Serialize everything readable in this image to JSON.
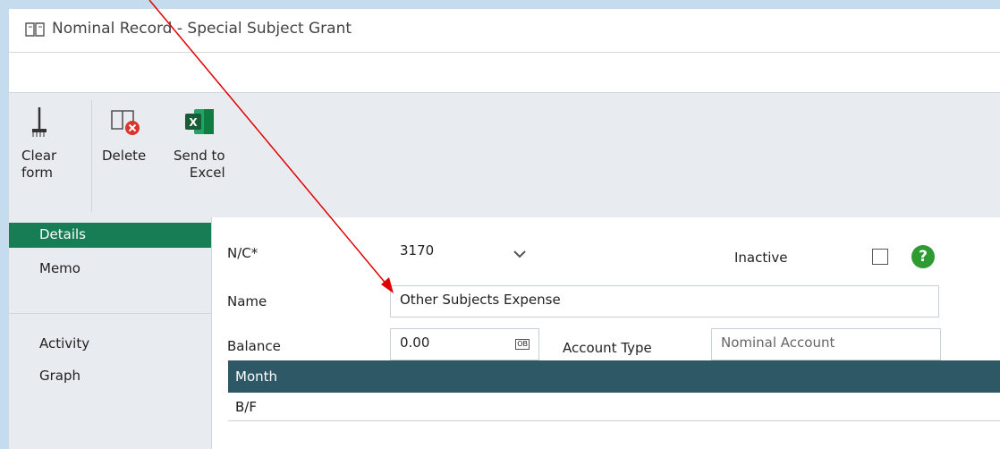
{
  "window": {
    "title": "Nominal Record - Special Subject Grant"
  },
  "toolbar": {
    "clear_form": "Clear\nform",
    "delete": "Delete",
    "send_to_excel": "Send to\nExcel"
  },
  "sidebar": {
    "items": [
      {
        "label": "Details",
        "active": true
      },
      {
        "label": "Memo",
        "active": false
      },
      {
        "label": "Activity",
        "active": false
      },
      {
        "label": "Graph",
        "active": false
      }
    ]
  },
  "form": {
    "nc_label": "N/C*",
    "nc_value": "3170",
    "inactive_label": "Inactive",
    "inactive_checked": false,
    "name_label": "Name",
    "name_value": "Other Subjects Expense",
    "balance_label": "Balance",
    "balance_value": "0.00",
    "ob_icon": "OB",
    "account_type_label": "Account Type",
    "account_type_value": "Nominal Account",
    "help_icon": "?"
  },
  "grid": {
    "header": "Month",
    "rows": [
      "B/F"
    ]
  },
  "colors": {
    "active_nav": "#167d55",
    "grid_header": "#2f5866",
    "annotation_arrow": "#e00000"
  }
}
